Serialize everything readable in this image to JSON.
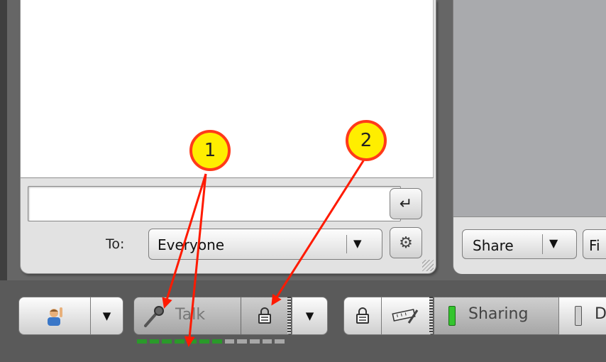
{
  "chat": {
    "input_value": "",
    "send_icon": "return-arrow-icon",
    "to_label": "To:",
    "recipient": "Everyone",
    "dropdown_glyph": "▼",
    "options_icon": "gear-icon"
  },
  "share_panel": {
    "share_label": "Share",
    "dropdown_glyph": "▼",
    "next_label": "Fi"
  },
  "toolbar": {
    "status_icon": "user-raise-hand-icon",
    "dropdown_glyph": "▼",
    "talk_label": "Talk",
    "talk_lock_icon": "lock-icon",
    "lock_icon": "lock-icon",
    "tools_icon": "ruler-pencil-icon",
    "sharing_label": "Sharing",
    "next_toggle_label": "D",
    "talk_level": {
      "active_segments": 7,
      "total_segments": 12
    }
  },
  "annotations": [
    {
      "number": "1"
    },
    {
      "number": "2"
    }
  ],
  "colors": {
    "callout_fill": "#ffee00",
    "callout_border": "#ff3a1a",
    "arrow": "#ff1a00",
    "meter_active": "#2a9a2a",
    "meter_inactive": "#a7a7a7",
    "sharing_on": "#34c52e"
  }
}
